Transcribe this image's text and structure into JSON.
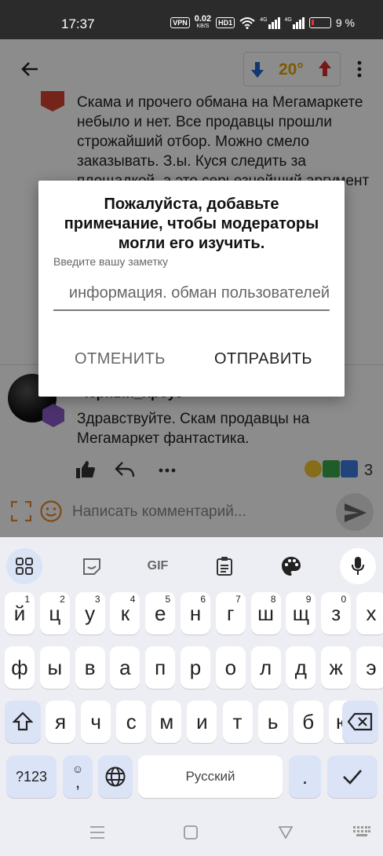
{
  "status": {
    "time": "17:37",
    "vpn": "VPN",
    "speed_top": "0.02",
    "speed_unit": "KB/S",
    "hd": "HD1",
    "net1": "4G",
    "net2": "4G",
    "battery": "9 %"
  },
  "header": {
    "temperature": "20°"
  },
  "comment1": {
    "text": "Скама и прочего обмана на Мегамаркете небыло и нет. Все продавцы прошли строжайший отбор. Можно смело заказывать. З.ы. Куся следить за площадкой, а это серьезнейший аргумент"
  },
  "comment2": {
    "author": "Черный_Кроуз",
    "text": "Здравствуйте.  Скам продавцы на Мегамаркет фантастика.",
    "reaction_count": "3"
  },
  "dialog": {
    "title": "Пожалуйста, добавьте примечание, чтобы модераторы могли его изучить.",
    "label": "Введите вашу заметку",
    "input_value": "информация. обман пользователей",
    "cancel": "ОТМЕНИТЬ",
    "submit": "ОТПРАВИТЬ"
  },
  "comment_bar": {
    "placeholder": "Написать комментарий..."
  },
  "keyboard": {
    "toolbar": {
      "gif": "GIF"
    },
    "row1": [
      {
        "k": "й",
        "n": "1"
      },
      {
        "k": "ц",
        "n": "2"
      },
      {
        "k": "у",
        "n": "3"
      },
      {
        "k": "к",
        "n": "4"
      },
      {
        "k": "е",
        "n": "5"
      },
      {
        "k": "н",
        "n": "6"
      },
      {
        "k": "г",
        "n": "7"
      },
      {
        "k": "ш",
        "n": "8"
      },
      {
        "k": "щ",
        "n": "9"
      },
      {
        "k": "з",
        "n": "0"
      },
      {
        "k": "х",
        "n": ""
      }
    ],
    "row2": [
      "ф",
      "ы",
      "в",
      "а",
      "п",
      "р",
      "о",
      "л",
      "д",
      "ж",
      "э"
    ],
    "row3": [
      "я",
      "ч",
      "с",
      "м",
      "и",
      "т",
      "ь",
      "б",
      "ю"
    ],
    "sym": "?123",
    "comma": ",",
    "space": "Русский",
    "period": "."
  },
  "colors": {
    "accent": "#e5a400",
    "down_arrow": "#2267d4",
    "up_arrow": "#d62c2c",
    "key_fn": "#dbe3f7"
  }
}
